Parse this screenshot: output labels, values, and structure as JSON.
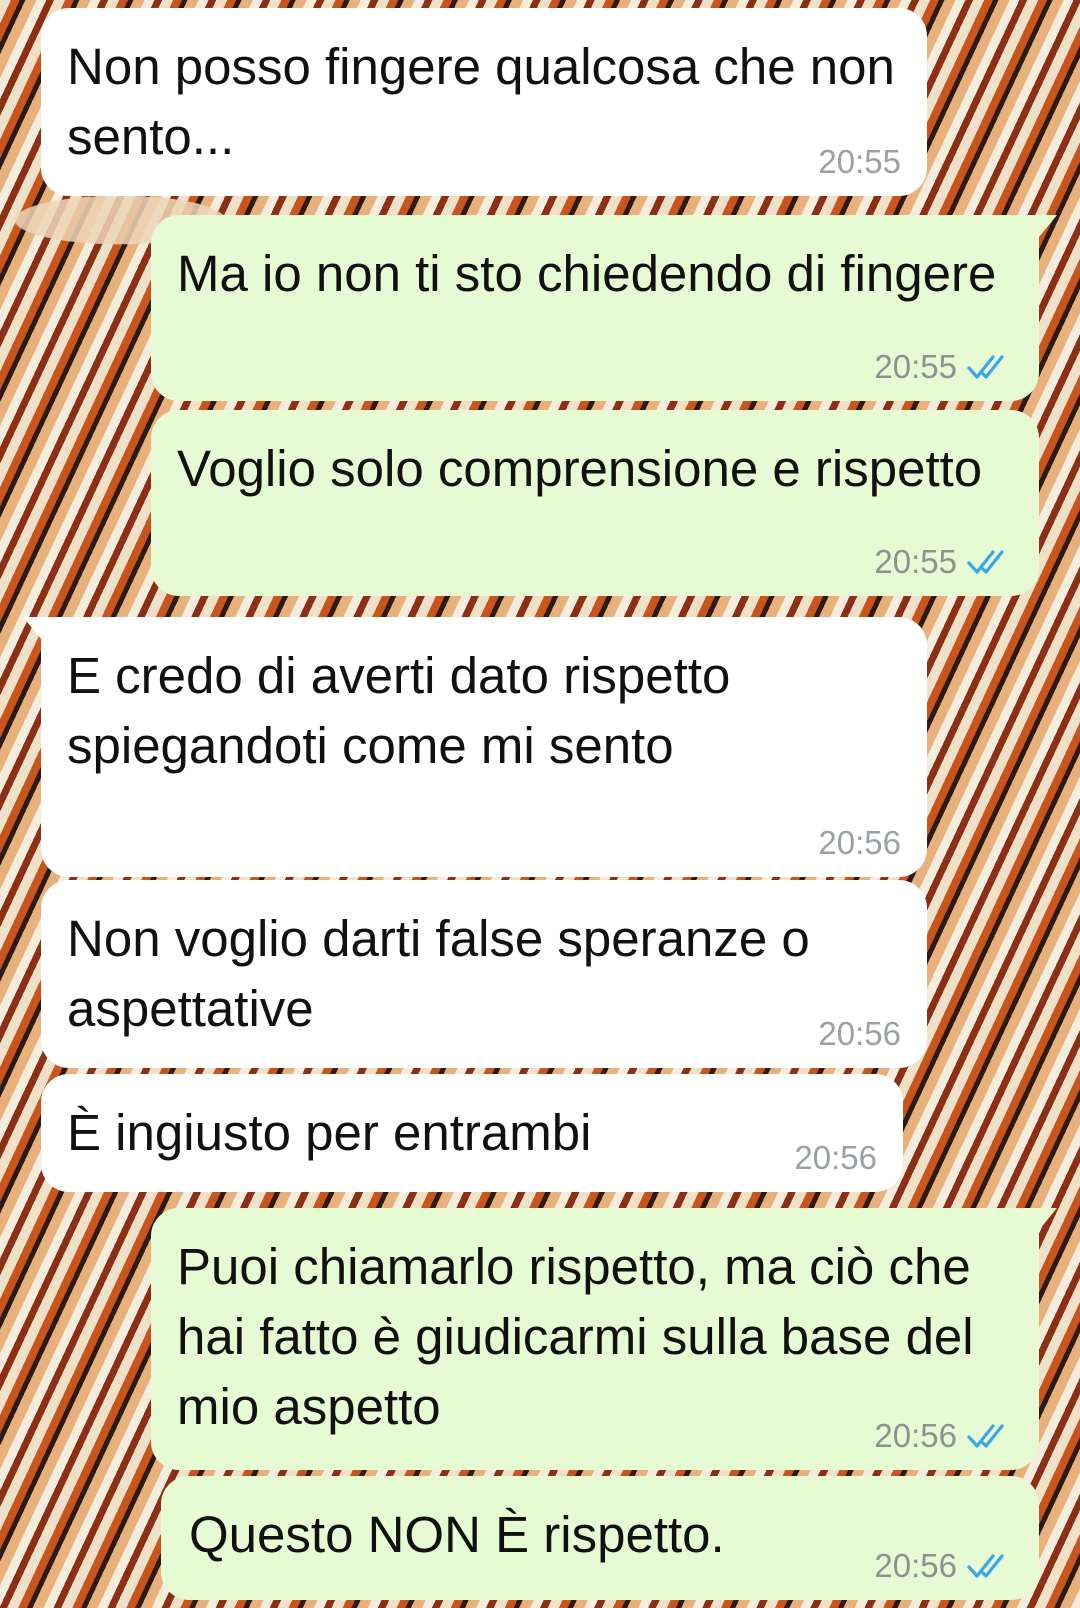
{
  "messages": [
    {
      "direction": "in",
      "text": "Non posso fingere qualcosa che non sento...",
      "time": "20:55",
      "read_receipt": false
    },
    {
      "direction": "out",
      "text": "Ma io non ti sto chiedendo di fingere",
      "time": "20:55",
      "read_receipt": true
    },
    {
      "direction": "out",
      "text": "Voglio solo comprensione e rispetto",
      "time": "20:55",
      "read_receipt": true
    },
    {
      "direction": "in",
      "text": "E credo di averti dato rispetto spiegandoti come mi sento",
      "time": "20:56",
      "read_receipt": false
    },
    {
      "direction": "in",
      "text": "Non voglio darti false speranze o aspettative",
      "time": "20:56",
      "read_receipt": false
    },
    {
      "direction": "in",
      "text": "È ingiusto per entrambi",
      "time": "20:56",
      "read_receipt": false
    },
    {
      "direction": "out",
      "text": "Puoi chiamarlo rispetto, ma ciò che hai fatto è giudicarmi sulla base del mio aspetto",
      "time": "20:56",
      "read_receipt": true
    },
    {
      "direction": "out",
      "text": "Questo NON È rispetto.",
      "time": "20:56",
      "read_receipt": true
    }
  ],
  "colors": {
    "incoming_bubble": "#ffffff",
    "outgoing_bubble": "#e6fbd4",
    "read_ticks": "#3aa6e8",
    "timestamp": "#9aa0a3"
  },
  "icons": {
    "read_receipt": "double-check-icon"
  }
}
